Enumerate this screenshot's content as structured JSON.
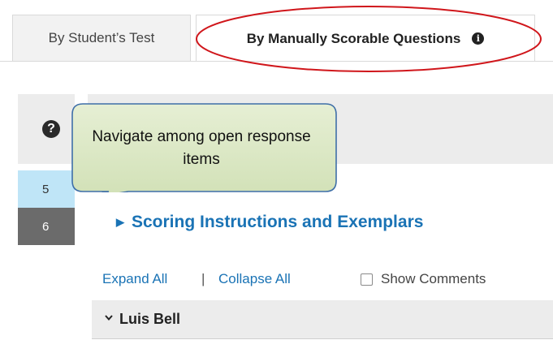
{
  "tabs": {
    "students_test": "By Student’s Test",
    "manually_scorable": "By Manually Scorable Questions",
    "info_icon": "info-icon"
  },
  "question_nav": {
    "help_icon": "?",
    "items": [
      {
        "number": "5",
        "state": "selected"
      },
      {
        "number": "6",
        "state": "current"
      }
    ]
  },
  "callout": {
    "text": "Navigate among open response items"
  },
  "scoring": {
    "label": "Scoring Instructions and Exemplars"
  },
  "toolbar": {
    "expand_all": "Expand All",
    "separator": "|",
    "collapse_all": "Collapse All",
    "show_comments": "Show Comments"
  },
  "students": [
    {
      "name": "Luis Bell"
    }
  ],
  "colors": {
    "link": "#1a73b5",
    "highlight": "#d0161b",
    "callout_fill": "#dbe8c4",
    "selected_question": "#bfe5f7",
    "current_question": "#6b6b6b"
  }
}
